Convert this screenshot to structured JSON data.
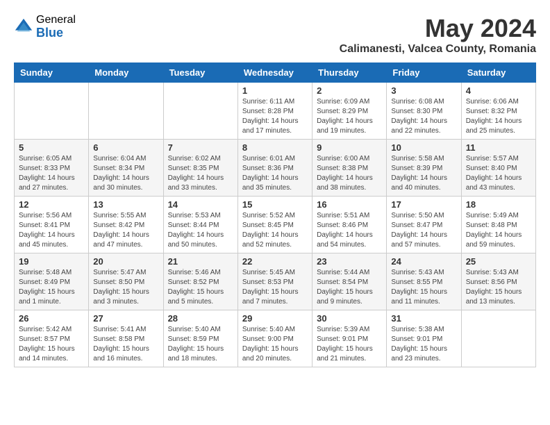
{
  "header": {
    "logo_general": "General",
    "logo_blue": "Blue",
    "month_title": "May 2024",
    "location": "Calimanesti, Valcea County, Romania"
  },
  "weekdays": [
    "Sunday",
    "Monday",
    "Tuesday",
    "Wednesday",
    "Thursday",
    "Friday",
    "Saturday"
  ],
  "weeks": [
    [
      {
        "day": "",
        "info": ""
      },
      {
        "day": "",
        "info": ""
      },
      {
        "day": "",
        "info": ""
      },
      {
        "day": "1",
        "info": "Sunrise: 6:11 AM\nSunset: 8:28 PM\nDaylight: 14 hours and 17 minutes."
      },
      {
        "day": "2",
        "info": "Sunrise: 6:09 AM\nSunset: 8:29 PM\nDaylight: 14 hours and 19 minutes."
      },
      {
        "day": "3",
        "info": "Sunrise: 6:08 AM\nSunset: 8:30 PM\nDaylight: 14 hours and 22 minutes."
      },
      {
        "day": "4",
        "info": "Sunrise: 6:06 AM\nSunset: 8:32 PM\nDaylight: 14 hours and 25 minutes."
      }
    ],
    [
      {
        "day": "5",
        "info": "Sunrise: 6:05 AM\nSunset: 8:33 PM\nDaylight: 14 hours and 27 minutes."
      },
      {
        "day": "6",
        "info": "Sunrise: 6:04 AM\nSunset: 8:34 PM\nDaylight: 14 hours and 30 minutes."
      },
      {
        "day": "7",
        "info": "Sunrise: 6:02 AM\nSunset: 8:35 PM\nDaylight: 14 hours and 33 minutes."
      },
      {
        "day": "8",
        "info": "Sunrise: 6:01 AM\nSunset: 8:36 PM\nDaylight: 14 hours and 35 minutes."
      },
      {
        "day": "9",
        "info": "Sunrise: 6:00 AM\nSunset: 8:38 PM\nDaylight: 14 hours and 38 minutes."
      },
      {
        "day": "10",
        "info": "Sunrise: 5:58 AM\nSunset: 8:39 PM\nDaylight: 14 hours and 40 minutes."
      },
      {
        "day": "11",
        "info": "Sunrise: 5:57 AM\nSunset: 8:40 PM\nDaylight: 14 hours and 43 minutes."
      }
    ],
    [
      {
        "day": "12",
        "info": "Sunrise: 5:56 AM\nSunset: 8:41 PM\nDaylight: 14 hours and 45 minutes."
      },
      {
        "day": "13",
        "info": "Sunrise: 5:55 AM\nSunset: 8:42 PM\nDaylight: 14 hours and 47 minutes."
      },
      {
        "day": "14",
        "info": "Sunrise: 5:53 AM\nSunset: 8:44 PM\nDaylight: 14 hours and 50 minutes."
      },
      {
        "day": "15",
        "info": "Sunrise: 5:52 AM\nSunset: 8:45 PM\nDaylight: 14 hours and 52 minutes."
      },
      {
        "day": "16",
        "info": "Sunrise: 5:51 AM\nSunset: 8:46 PM\nDaylight: 14 hours and 54 minutes."
      },
      {
        "day": "17",
        "info": "Sunrise: 5:50 AM\nSunset: 8:47 PM\nDaylight: 14 hours and 57 minutes."
      },
      {
        "day": "18",
        "info": "Sunrise: 5:49 AM\nSunset: 8:48 PM\nDaylight: 14 hours and 59 minutes."
      }
    ],
    [
      {
        "day": "19",
        "info": "Sunrise: 5:48 AM\nSunset: 8:49 PM\nDaylight: 15 hours and 1 minute."
      },
      {
        "day": "20",
        "info": "Sunrise: 5:47 AM\nSunset: 8:50 PM\nDaylight: 15 hours and 3 minutes."
      },
      {
        "day": "21",
        "info": "Sunrise: 5:46 AM\nSunset: 8:52 PM\nDaylight: 15 hours and 5 minutes."
      },
      {
        "day": "22",
        "info": "Sunrise: 5:45 AM\nSunset: 8:53 PM\nDaylight: 15 hours and 7 minutes."
      },
      {
        "day": "23",
        "info": "Sunrise: 5:44 AM\nSunset: 8:54 PM\nDaylight: 15 hours and 9 minutes."
      },
      {
        "day": "24",
        "info": "Sunrise: 5:43 AM\nSunset: 8:55 PM\nDaylight: 15 hours and 11 minutes."
      },
      {
        "day": "25",
        "info": "Sunrise: 5:43 AM\nSunset: 8:56 PM\nDaylight: 15 hours and 13 minutes."
      }
    ],
    [
      {
        "day": "26",
        "info": "Sunrise: 5:42 AM\nSunset: 8:57 PM\nDaylight: 15 hours and 14 minutes."
      },
      {
        "day": "27",
        "info": "Sunrise: 5:41 AM\nSunset: 8:58 PM\nDaylight: 15 hours and 16 minutes."
      },
      {
        "day": "28",
        "info": "Sunrise: 5:40 AM\nSunset: 8:59 PM\nDaylight: 15 hours and 18 minutes."
      },
      {
        "day": "29",
        "info": "Sunrise: 5:40 AM\nSunset: 9:00 PM\nDaylight: 15 hours and 20 minutes."
      },
      {
        "day": "30",
        "info": "Sunrise: 5:39 AM\nSunset: 9:01 PM\nDaylight: 15 hours and 21 minutes."
      },
      {
        "day": "31",
        "info": "Sunrise: 5:38 AM\nSunset: 9:01 PM\nDaylight: 15 hours and 23 minutes."
      },
      {
        "day": "",
        "info": ""
      }
    ]
  ]
}
